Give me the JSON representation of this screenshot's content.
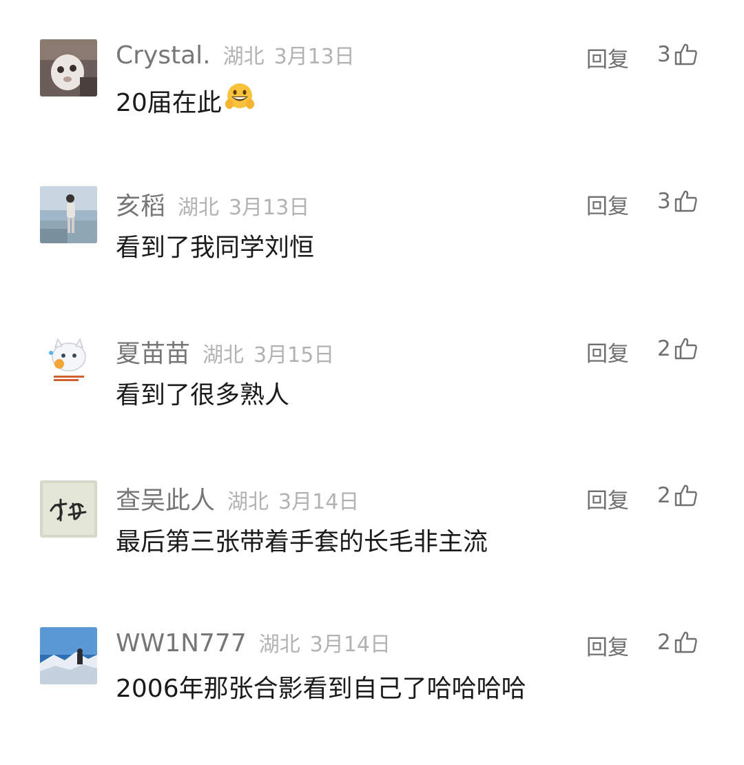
{
  "comments": [
    {
      "username": "Crystal.",
      "region": "湖北",
      "date": "3月13日",
      "text": "20届在此",
      "emoji": "grinning-face-icon",
      "reply_label": "回复",
      "likes": "3",
      "avatar": "avatar-crystal"
    },
    {
      "username": "亥稻",
      "region": "湖北",
      "date": "3月13日",
      "text": "看到了我同学刘恒",
      "reply_label": "回复",
      "likes": "3",
      "avatar": "avatar-beach-person"
    },
    {
      "username": "夏苗苗",
      "region": "湖北",
      "date": "3月15日",
      "text": "看到了很多熟人",
      "reply_label": "回复",
      "likes": "2",
      "avatar": "avatar-cartoon-cat"
    },
    {
      "username": "查吴此人",
      "region": "湖北",
      "date": "3月14日",
      "text": "最后第三张带着手套的长毛非主流",
      "reply_label": "回复",
      "likes": "2",
      "avatar": "avatar-calligraphy"
    },
    {
      "username": "WW1N777",
      "region": "湖北",
      "date": "3月14日",
      "text": "2006年那张合影看到自己了哈哈哈哈",
      "reply_label": "回复",
      "likes": "2",
      "avatar": "avatar-snow-mountain"
    }
  ],
  "colors": {
    "username": "#767676",
    "meta": "#b2b2b2",
    "text": "#1a1a1a",
    "action": "#6f6f6f"
  }
}
